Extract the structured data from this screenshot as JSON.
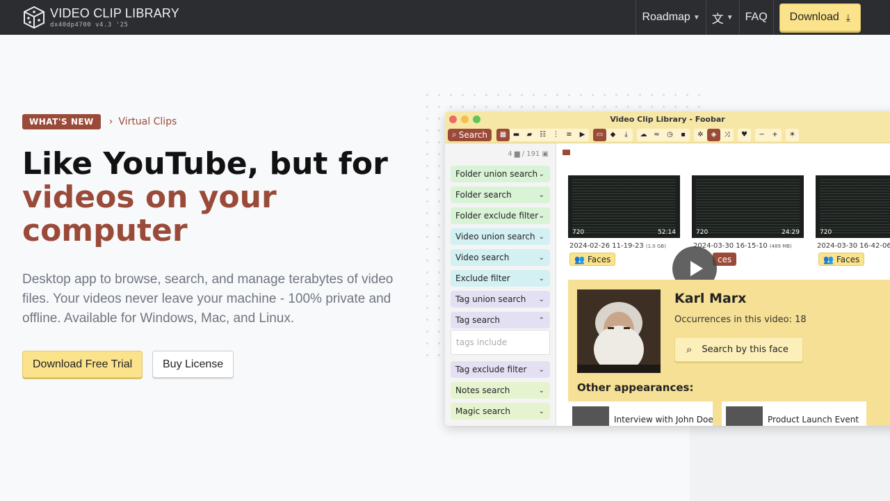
{
  "nav": {
    "title": "VIDEO CLIP LIBRARY",
    "subtitle": "dx40dp4700 v4.3 '25",
    "roadmap": "Roadmap",
    "faq": "FAQ",
    "download": "Download"
  },
  "hero": {
    "badge": "WHAT'S NEW",
    "news_link": "Virtual Clips",
    "title_line1": "Like YouTube, but for",
    "title_accent": "videos on your computer",
    "description": "Desktop app to browse, search, and manage terabytes of video files. Your videos never leave your machine - 100% private and offline. Available for Windows, Mac, and Linux.",
    "trial_button": "Download Free Trial",
    "buy_button": "Buy License"
  },
  "app": {
    "window_title": "Video Clip Library - Foobar",
    "search_tab": "Search",
    "count": "4 ▆ / 191 ▣",
    "filters": {
      "folder_union": "Folder union search",
      "folder_search": "Folder search",
      "folder_exclude": "Folder exclude filter",
      "video_union": "Video union search",
      "video_search": "Video search",
      "exclude_filter": "Exclude filter",
      "tag_union": "Tag union search",
      "tag_search": "Tag search",
      "tags_placeholder": "tags include",
      "tag_exclude": "Tag exclude filter",
      "notes_search": "Notes search",
      "magic_search": "Magic search"
    },
    "videos": [
      {
        "res": "720",
        "duration": "52:14",
        "date": "2024-02-26 11-19-23",
        "size": "(1.0 GB)",
        "faces": "Faces"
      },
      {
        "res": "720",
        "duration": "24:29",
        "date": "2024-03-30 16-15-10",
        "size": "(489 MB)",
        "faces": "ces"
      },
      {
        "res": "720",
        "duration": "",
        "date": "2024-03-30 16-42-06",
        "size": "",
        "faces": "Faces"
      }
    ],
    "face": {
      "name": "Karl Marx",
      "occurrences": "Occurrences in this video: 18",
      "search_button": "Search by this face",
      "other_title": "Other appearances:",
      "appearances": [
        "Interview with John Doe",
        "Product Launch Event"
      ]
    }
  }
}
